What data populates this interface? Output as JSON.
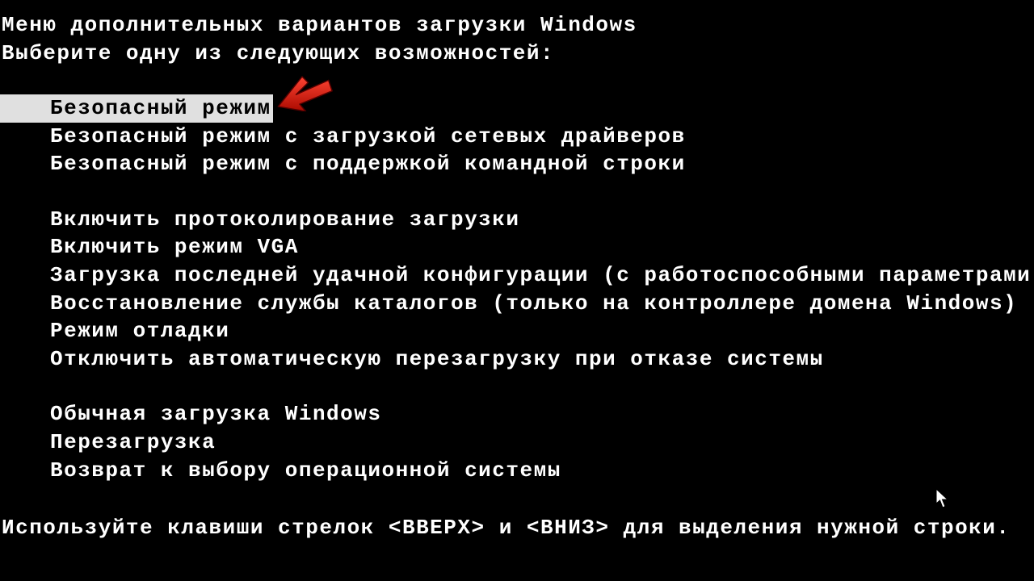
{
  "title": "Меню дополнительных вариантов загрузки Windows",
  "prompt": "Выберите одну из следующих возможностей:",
  "group1": [
    "Безопасный режим",
    "Безопасный режим с загрузкой сетевых драйверов",
    "Безопасный режим с поддержкой командной строки"
  ],
  "group2": [
    "Включить протоколирование загрузки",
    "Включить режим VGA",
    "Загрузка последней удачной конфигурации (с работоспособными параметрами)",
    "Восстановление службы каталогов (только на контроллере домена Windows)",
    "Режим отладки",
    "Отключить автоматическую перезагрузку при отказе системы"
  ],
  "group3": [
    "Обычная загрузка Windows",
    "Перезагрузка",
    "Возврат к выбору операционной системы"
  ],
  "footer": "Используйте клавиши стрелок <ВВЕРХ> и <ВНИЗ> для выделения нужной строки.",
  "selected_index": 0
}
